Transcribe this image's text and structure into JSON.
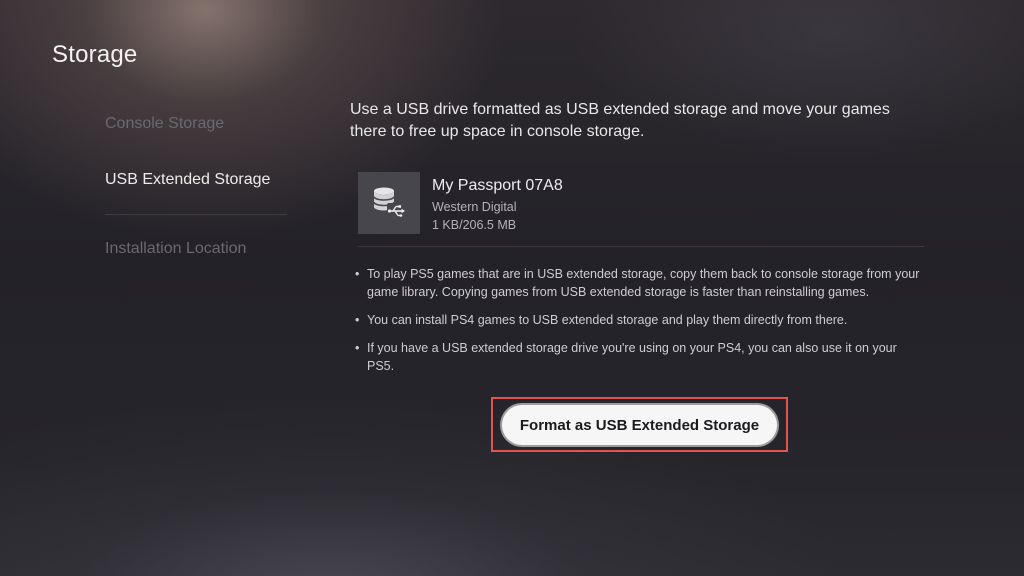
{
  "header": {
    "title": "Storage"
  },
  "sidebar": {
    "items": [
      {
        "label": "Console Storage",
        "state": "inactive"
      },
      {
        "label": "USB Extended Storage",
        "state": "selected"
      },
      {
        "label": "Installation Location",
        "state": "inactive"
      }
    ]
  },
  "main": {
    "intro": "Use a USB drive formatted as USB extended storage and move your games there to free up space in console storage.",
    "drive": {
      "icon": "usb-drive-icon",
      "name": "My Passport 07A8",
      "maker": "Western Digital",
      "usage": "1 KB/206.5 MB"
    },
    "notes": [
      "To play PS5 games that are in USB extended storage, copy them back to console storage from your game library. Copying games from USB extended storage is faster than reinstalling games.",
      "You can install PS4 games to USB extended storage and play them directly from there.",
      "If you have a USB extended storage drive you're using on your PS4, you can also use it on your PS5."
    ],
    "format_button": {
      "label": "Format as USB Extended Storage"
    }
  },
  "colors": {
    "highlight": "#e5534b",
    "button_bg": "#f6f6f6",
    "background": "#232228"
  }
}
